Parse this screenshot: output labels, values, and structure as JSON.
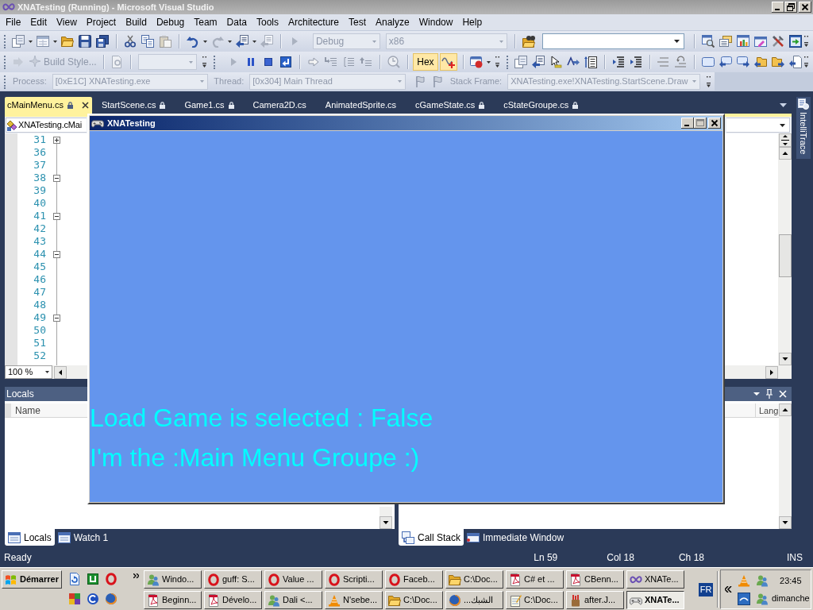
{
  "window": {
    "title": "XNATesting (Running) - Microsoft Visual Studio"
  },
  "menu": [
    "File",
    "Edit",
    "View",
    "Project",
    "Build",
    "Debug",
    "Team",
    "Data",
    "Tools",
    "Architecture",
    "Test",
    "Analyze",
    "Window",
    "Help"
  ],
  "standard_toolbar": {
    "configuration": {
      "value": "Debug",
      "disabled": true
    },
    "platform": {
      "value": "x86",
      "disabled": true
    }
  },
  "build_style_toolbar": {
    "label": "Build Style...",
    "disabled": true
  },
  "debug_toolbar": {
    "hex": {
      "label": "Hex",
      "selected": true
    },
    "wave_toggle": {
      "selected": true
    }
  },
  "debug_location": {
    "disabled": true,
    "process_label": "Process:",
    "process": "[0xE1C] XNATesting.exe",
    "thread_label": "Thread:",
    "thread": "[0x304] Main Thread",
    "stack_frame_label": "Stack Frame:",
    "stack_frame": "XNATesting.exe!XNATesting.StartScene.Draw"
  },
  "document_tabs": [
    {
      "label": "cMainMenu.cs",
      "selected": true,
      "locked": true
    },
    {
      "label": "StartScene.cs",
      "selected": false,
      "locked": true
    },
    {
      "label": "Game1.cs",
      "selected": false,
      "locked": true
    },
    {
      "label": "Camera2D.cs",
      "selected": false,
      "locked": false
    },
    {
      "label": "AnimatedSprite.cs",
      "selected": false,
      "locked": false
    },
    {
      "label": "cGameState.cs",
      "selected": false,
      "locked": true
    },
    {
      "label": "cStateGroupe.cs",
      "selected": false,
      "locked": true
    }
  ],
  "side_tab": {
    "label": "IntelliTrace"
  },
  "editor": {
    "type_dropdown": "XNATesting.cMai",
    "lines": [
      {
        "number": "31",
        "kind": "collapsed"
      },
      {
        "number": "36",
        "kind": "plain"
      },
      {
        "number": "37",
        "kind": "plain"
      },
      {
        "number": "38",
        "kind": "expanded"
      },
      {
        "number": "39",
        "kind": "plain"
      },
      {
        "number": "40",
        "kind": "plain"
      },
      {
        "number": "41",
        "kind": "expanded"
      },
      {
        "number": "42",
        "kind": "plain"
      },
      {
        "number": "43",
        "kind": "plain"
      },
      {
        "number": "44",
        "kind": "expanded"
      },
      {
        "number": "45",
        "kind": "plain"
      },
      {
        "number": "46",
        "kind": "plain"
      },
      {
        "number": "47",
        "kind": "plain"
      },
      {
        "number": "48",
        "kind": "plain"
      },
      {
        "number": "49",
        "kind": "expanded"
      },
      {
        "number": "50",
        "kind": "plain"
      },
      {
        "number": "51",
        "kind": "plain"
      },
      {
        "number": "52",
        "kind": "plain"
      }
    ],
    "zoom": "100 %"
  },
  "locals_panel": {
    "title": "Locals",
    "columns": [
      "Name"
    ]
  },
  "call_stack_panel": {
    "columns": [
      "Lang"
    ]
  },
  "left_panel_tabs": [
    {
      "label": "Locals",
      "selected": true
    },
    {
      "label": "Watch 1",
      "selected": false
    }
  ],
  "right_panel_tabs": [
    {
      "label": "Call Stack",
      "selected": true
    },
    {
      "label": "Immediate Window",
      "selected": false
    }
  ],
  "status_bar": {
    "message": "Ready",
    "line": "Ln 59",
    "column": "Col 18",
    "character": "Ch 18",
    "mode": "INS"
  },
  "game_window": {
    "title": "XNATesting",
    "lines": [
      "Load Game is selected : False",
      "I'm the :Main Menu Groupe :)"
    ]
  },
  "taskbar": {
    "start": "Démarrer",
    "task_rows": [
      [
        {
          "label": "Windo...",
          "selected": false
        },
        {
          "label": "guff: S...",
          "selected": false
        },
        {
          "label": "Value ...",
          "selected": false
        },
        {
          "label": "Scripti...",
          "selected": false
        },
        {
          "label": "Faceb...",
          "selected": false
        },
        {
          "label": "C:\\Doc...",
          "selected": false
        },
        {
          "label": "C# et ...",
          "selected": false
        },
        {
          "label": "CBenn...",
          "selected": false
        },
        {
          "label": "XNATe...",
          "selected": false
        }
      ],
      [
        {
          "label": "Beginn...",
          "selected": false
        },
        {
          "label": "Dévelo...",
          "selected": false
        },
        {
          "label": "Dali <...",
          "selected": false
        },
        {
          "label": "N'sebe...",
          "selected": false
        },
        {
          "label": "C:\\Doc...",
          "selected": false
        },
        {
          "label": "الشبك...",
          "selected": false
        },
        {
          "label": "C:\\Doc...",
          "selected": false
        },
        {
          "label": "after.J...",
          "selected": false
        },
        {
          "label": "XNATe...",
          "selected": true
        }
      ]
    ],
    "language": "FR",
    "clock": "23:45",
    "day": "dimanche"
  }
}
